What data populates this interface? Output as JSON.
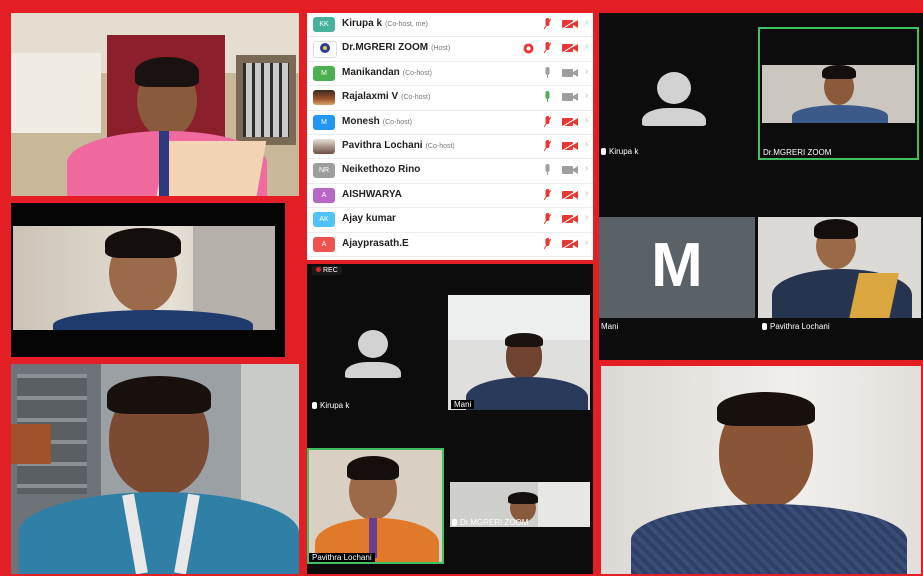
{
  "participants": [
    {
      "initials": "KK",
      "name": "Kirupa k",
      "role": "(Co-host, me)",
      "avatar_color": "#46b29d",
      "mic": "muted",
      "video": "off"
    },
    {
      "initials": "",
      "name": "Dr.MGRERI ZOOM",
      "role": "(Host)",
      "avatar_color": "#2a3f8f",
      "mic": "muted",
      "video": "off",
      "badge": true
    },
    {
      "initials": "M",
      "name": "Manikandan",
      "role": "(Co-host)",
      "avatar_color": "#4caf50",
      "mic": "on",
      "video": "on"
    },
    {
      "initials": "",
      "name": "Rajalaxmi V",
      "role": "(Co-host)",
      "avatar_color": "#a0522d",
      "mic": "active",
      "video": "on"
    },
    {
      "initials": "M",
      "name": "Monesh",
      "role": "(Co-host)",
      "avatar_color": "#2196f3",
      "mic": "muted",
      "video": "off"
    },
    {
      "initials": "",
      "name": "Pavithra Lochani",
      "role": "(Co-host)",
      "avatar_color": "#6d4c41",
      "mic": "muted",
      "video": "off"
    },
    {
      "initials": "NR",
      "name": "Neikethozo Rino",
      "role": "",
      "avatar_color": "#9e9e9e",
      "mic": "on",
      "video": "on"
    },
    {
      "initials": "A",
      "name": "AISHWARYA",
      "role": "",
      "avatar_color": "#ba68c8",
      "mic": "muted",
      "video": "off"
    },
    {
      "initials": "AK",
      "name": "Ajay kumar",
      "role": "",
      "avatar_color": "#4fc3f7",
      "mic": "muted",
      "video": "off"
    },
    {
      "initials": "A",
      "name": "Ajayprasath.E",
      "role": "",
      "avatar_color": "#ef5350",
      "mic": "muted",
      "video": "off"
    }
  ],
  "rec_label": "REC",
  "tiles": {
    "top_right_kirupa": "Kirupa k",
    "top_right_host": "Dr.MGRERI ZOOM",
    "mani_letter": "M",
    "mani": "Mani",
    "pavithra_top": "Pavithra Lochani",
    "center_kirupa": "Kirupa k",
    "center_mani": "Mani",
    "center_pavithra": "Pavithra Lochani",
    "center_host": "Dr.MGRERI ZOOM"
  },
  "colors": {
    "frame_red": "#e31e24",
    "muted_red": "#e53935",
    "active_green": "#4caf50",
    "tile_black": "#0c0c0c",
    "host_tile_border": "#3fbf5f"
  }
}
